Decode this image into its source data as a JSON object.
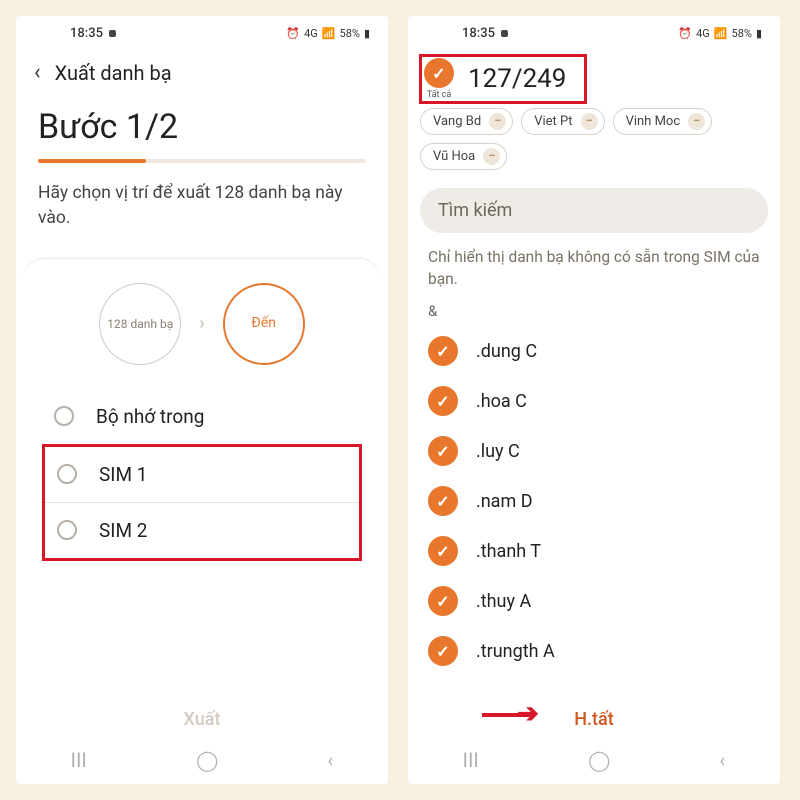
{
  "status": {
    "time": "18:35",
    "battery": "58%",
    "net": "4G"
  },
  "left": {
    "back_header": "Xuất danh bạ",
    "step_title": "Bước 1/2",
    "instruction": "Hãy chọn vị trí để xuất 128 danh bạ này vào.",
    "src_circle": "128 danh bạ",
    "dst_circle": "Đến",
    "options": {
      "internal": "Bộ nhớ trong",
      "sim1": "SIM 1",
      "sim2": "SIM 2"
    },
    "action": "Xuất"
  },
  "right": {
    "select_all": "Tất cả",
    "count": "127/249",
    "chips": [
      "Vang Bd",
      "Viet Pt",
      "Vinh Moc",
      "Vũ Hoa"
    ],
    "search_placeholder": "Tìm kiếm",
    "note": "Chỉ hiển thị danh bạ không có sẵn trong SIM của bạn.",
    "section": "&",
    "contacts": [
      ".dung C",
      ".hoa C",
      ".luy C",
      ".nam D",
      ".thanh T",
      ".thuy A",
      ".trungth A"
    ],
    "action": "H.tất"
  }
}
